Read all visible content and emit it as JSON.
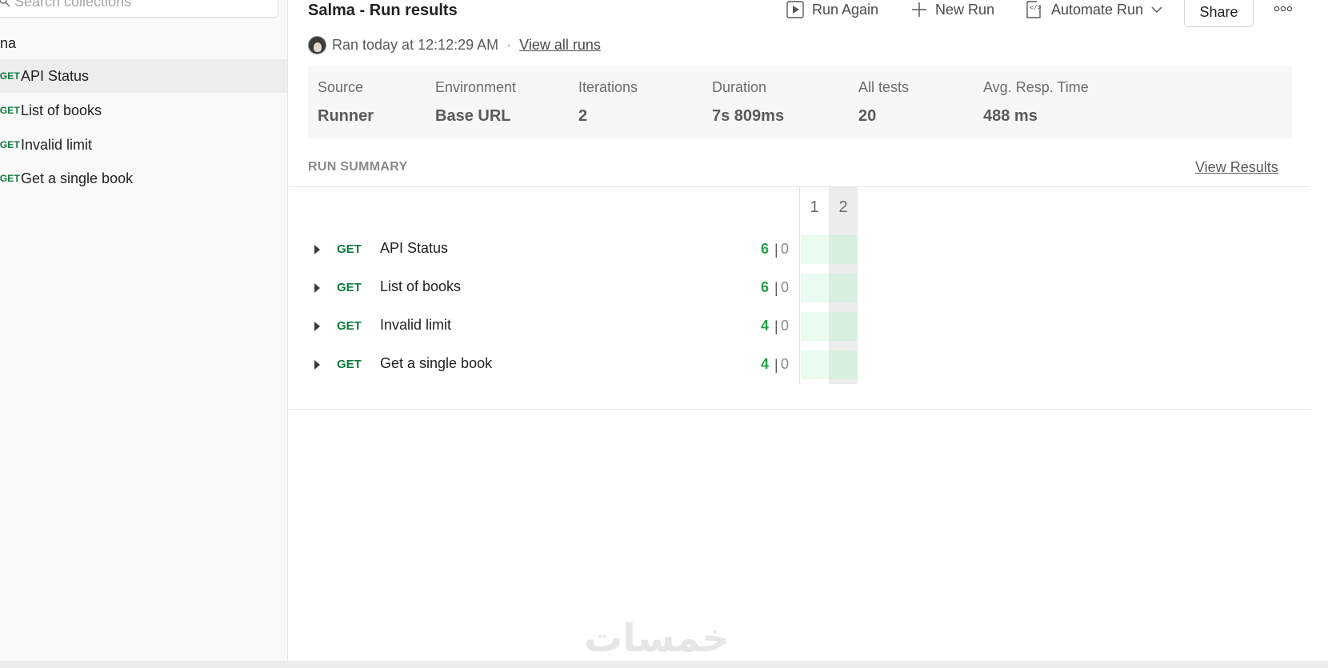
{
  "sidebar": {
    "search_placeholder": "Search collections",
    "collection_name": "na",
    "items": [
      {
        "method": "GET",
        "label": "API Status",
        "active": true
      },
      {
        "method": "GET",
        "label": "List of books",
        "active": false
      },
      {
        "method": "GET",
        "label": "Invalid limit",
        "active": false
      },
      {
        "method": "GET",
        "label": "Get a single book",
        "active": false
      }
    ]
  },
  "header": {
    "title": "Salma - Run results",
    "run_again": "Run Again",
    "new_run": "New Run",
    "automate_run": "Automate Run",
    "share": "Share"
  },
  "run_meta": {
    "ran_text": "Ran today at 12:12:29 AM",
    "separator": "·",
    "view_all_runs": "View all runs"
  },
  "stats": [
    {
      "label": "Source",
      "value": "Runner"
    },
    {
      "label": "Environment",
      "value": "Base URL"
    },
    {
      "label": "Iterations",
      "value": "2"
    },
    {
      "label": "Duration",
      "value": "7s 809ms"
    },
    {
      "label": "All tests",
      "value": "20"
    },
    {
      "label": "Avg. Resp. Time",
      "value": "488 ms"
    }
  ],
  "summary": {
    "label": "RUN SUMMARY",
    "view_results": "View Results",
    "iteration_headers": [
      "1",
      "2"
    ],
    "rows": [
      {
        "method": "GET",
        "name": "API Status",
        "passed": "6",
        "separator": "|",
        "failed": "0"
      },
      {
        "method": "GET",
        "name": "List of books",
        "passed": "6",
        "separator": "|",
        "failed": "0"
      },
      {
        "method": "GET",
        "name": "Invalid limit",
        "passed": "4",
        "separator": "|",
        "failed": "0"
      },
      {
        "method": "GET",
        "name": "Get a single book",
        "passed": "4",
        "separator": "|",
        "failed": "0"
      }
    ]
  },
  "watermark": "خمسات",
  "colors": {
    "method_green": "#0f7a3e",
    "pass_green": "#24a148",
    "cell_iter1": "#eafbf0",
    "cell_iter2": "#d6efdf"
  }
}
